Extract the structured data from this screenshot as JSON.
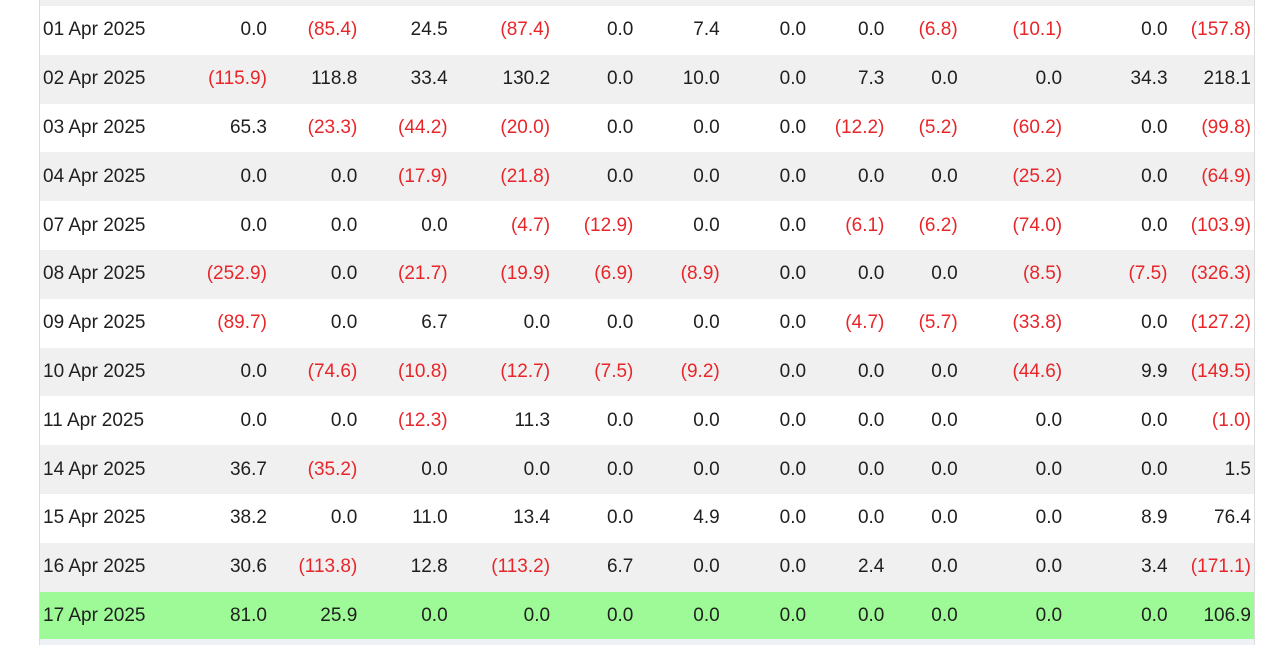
{
  "rows": [
    {
      "date": "01 Apr 2025",
      "values": [
        "0.0",
        "(85.4)",
        "24.5",
        "(87.4)",
        "0.0",
        "7.4",
        "0.0",
        "0.0",
        "(6.8)",
        "(10.1)",
        "0.0",
        "(157.8)"
      ]
    },
    {
      "date": "02 Apr 2025",
      "values": [
        "(115.9)",
        "118.8",
        "33.4",
        "130.2",
        "0.0",
        "10.0",
        "0.0",
        "7.3",
        "0.0",
        "0.0",
        "34.3",
        "218.1"
      ]
    },
    {
      "date": "03 Apr 2025",
      "values": [
        "65.3",
        "(23.3)",
        "(44.2)",
        "(20.0)",
        "0.0",
        "0.0",
        "0.0",
        "(12.2)",
        "(5.2)",
        "(60.2)",
        "0.0",
        "(99.8)"
      ]
    },
    {
      "date": "04 Apr 2025",
      "values": [
        "0.0",
        "0.0",
        "(17.9)",
        "(21.8)",
        "0.0",
        "0.0",
        "0.0",
        "0.0",
        "0.0",
        "(25.2)",
        "0.0",
        "(64.9)"
      ]
    },
    {
      "date": "07 Apr 2025",
      "values": [
        "0.0",
        "0.0",
        "0.0",
        "(4.7)",
        "(12.9)",
        "0.0",
        "0.0",
        "(6.1)",
        "(6.2)",
        "(74.0)",
        "0.0",
        "(103.9)"
      ]
    },
    {
      "date": "08 Apr 2025",
      "values": [
        "(252.9)",
        "0.0",
        "(21.7)",
        "(19.9)",
        "(6.9)",
        "(8.9)",
        "0.0",
        "0.0",
        "0.0",
        "(8.5)",
        "(7.5)",
        "(326.3)"
      ]
    },
    {
      "date": "09 Apr 2025",
      "values": [
        "(89.7)",
        "0.0",
        "6.7",
        "0.0",
        "0.0",
        "0.0",
        "0.0",
        "(4.7)",
        "(5.7)",
        "(33.8)",
        "0.0",
        "(127.2)"
      ]
    },
    {
      "date": "10 Apr 2025",
      "values": [
        "0.0",
        "(74.6)",
        "(10.8)",
        "(12.7)",
        "(7.5)",
        "(9.2)",
        "0.0",
        "0.0",
        "0.0",
        "(44.6)",
        "9.9",
        "(149.5)"
      ]
    },
    {
      "date": "11 Apr 2025",
      "values": [
        "0.0",
        "0.0",
        "(12.3)",
        "11.3",
        "0.0",
        "0.0",
        "0.0",
        "0.0",
        "0.0",
        "0.0",
        "0.0",
        "(1.0)"
      ]
    },
    {
      "date": "14 Apr 2025",
      "values": [
        "36.7",
        "(35.2)",
        "0.0",
        "0.0",
        "0.0",
        "0.0",
        "0.0",
        "0.0",
        "0.0",
        "0.0",
        "0.0",
        "1.5"
      ]
    },
    {
      "date": "15 Apr 2025",
      "values": [
        "38.2",
        "0.0",
        "11.0",
        "13.4",
        "0.0",
        "4.9",
        "0.0",
        "0.0",
        "0.0",
        "0.0",
        "8.9",
        "76.4"
      ]
    },
    {
      "date": "16 Apr 2025",
      "values": [
        "30.6",
        "(113.8)",
        "12.8",
        "(113.2)",
        "6.7",
        "0.0",
        "0.0",
        "2.4",
        "0.0",
        "0.0",
        "3.4",
        "(171.1)"
      ]
    },
    {
      "date": "17 Apr 2025",
      "values": [
        "81.0",
        "25.9",
        "0.0",
        "0.0",
        "0.0",
        "0.0",
        "0.0",
        "0.0",
        "0.0",
        "0.0",
        "0.0",
        "106.9"
      ],
      "highlighted": true
    }
  ],
  "colors": {
    "negative": "#e8262a",
    "text": "#1f1f1f",
    "row_alt": "#f0f0f0",
    "row_highlight": "#9dfa96"
  }
}
